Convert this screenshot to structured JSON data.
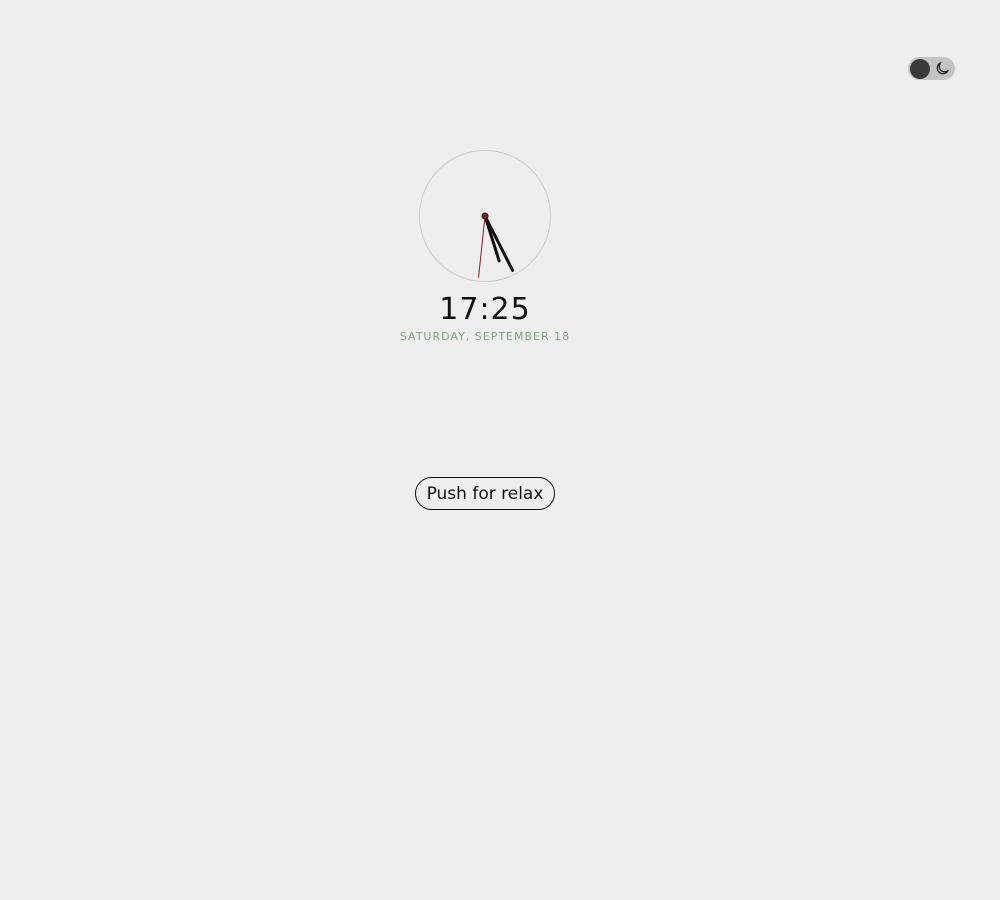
{
  "theme_toggle": {
    "icon": "moon-icon",
    "state": "dark-mode-off"
  },
  "clock": {
    "hour": 17,
    "minute": 25,
    "second": 31,
    "colors": {
      "face_border": "#cccccc",
      "hands": "#111111",
      "second_hand": "#8b1a1a"
    }
  },
  "time_display": "17:25",
  "date_display": "SATURDAY, SEPTEMBER 18",
  "relax_button": {
    "label": "Push for relax"
  },
  "colors": {
    "background": "#eeeeee",
    "date_text": "#7fa27f",
    "toggle_track": "#c4c4c4",
    "toggle_knob": "#3a3a3a"
  }
}
